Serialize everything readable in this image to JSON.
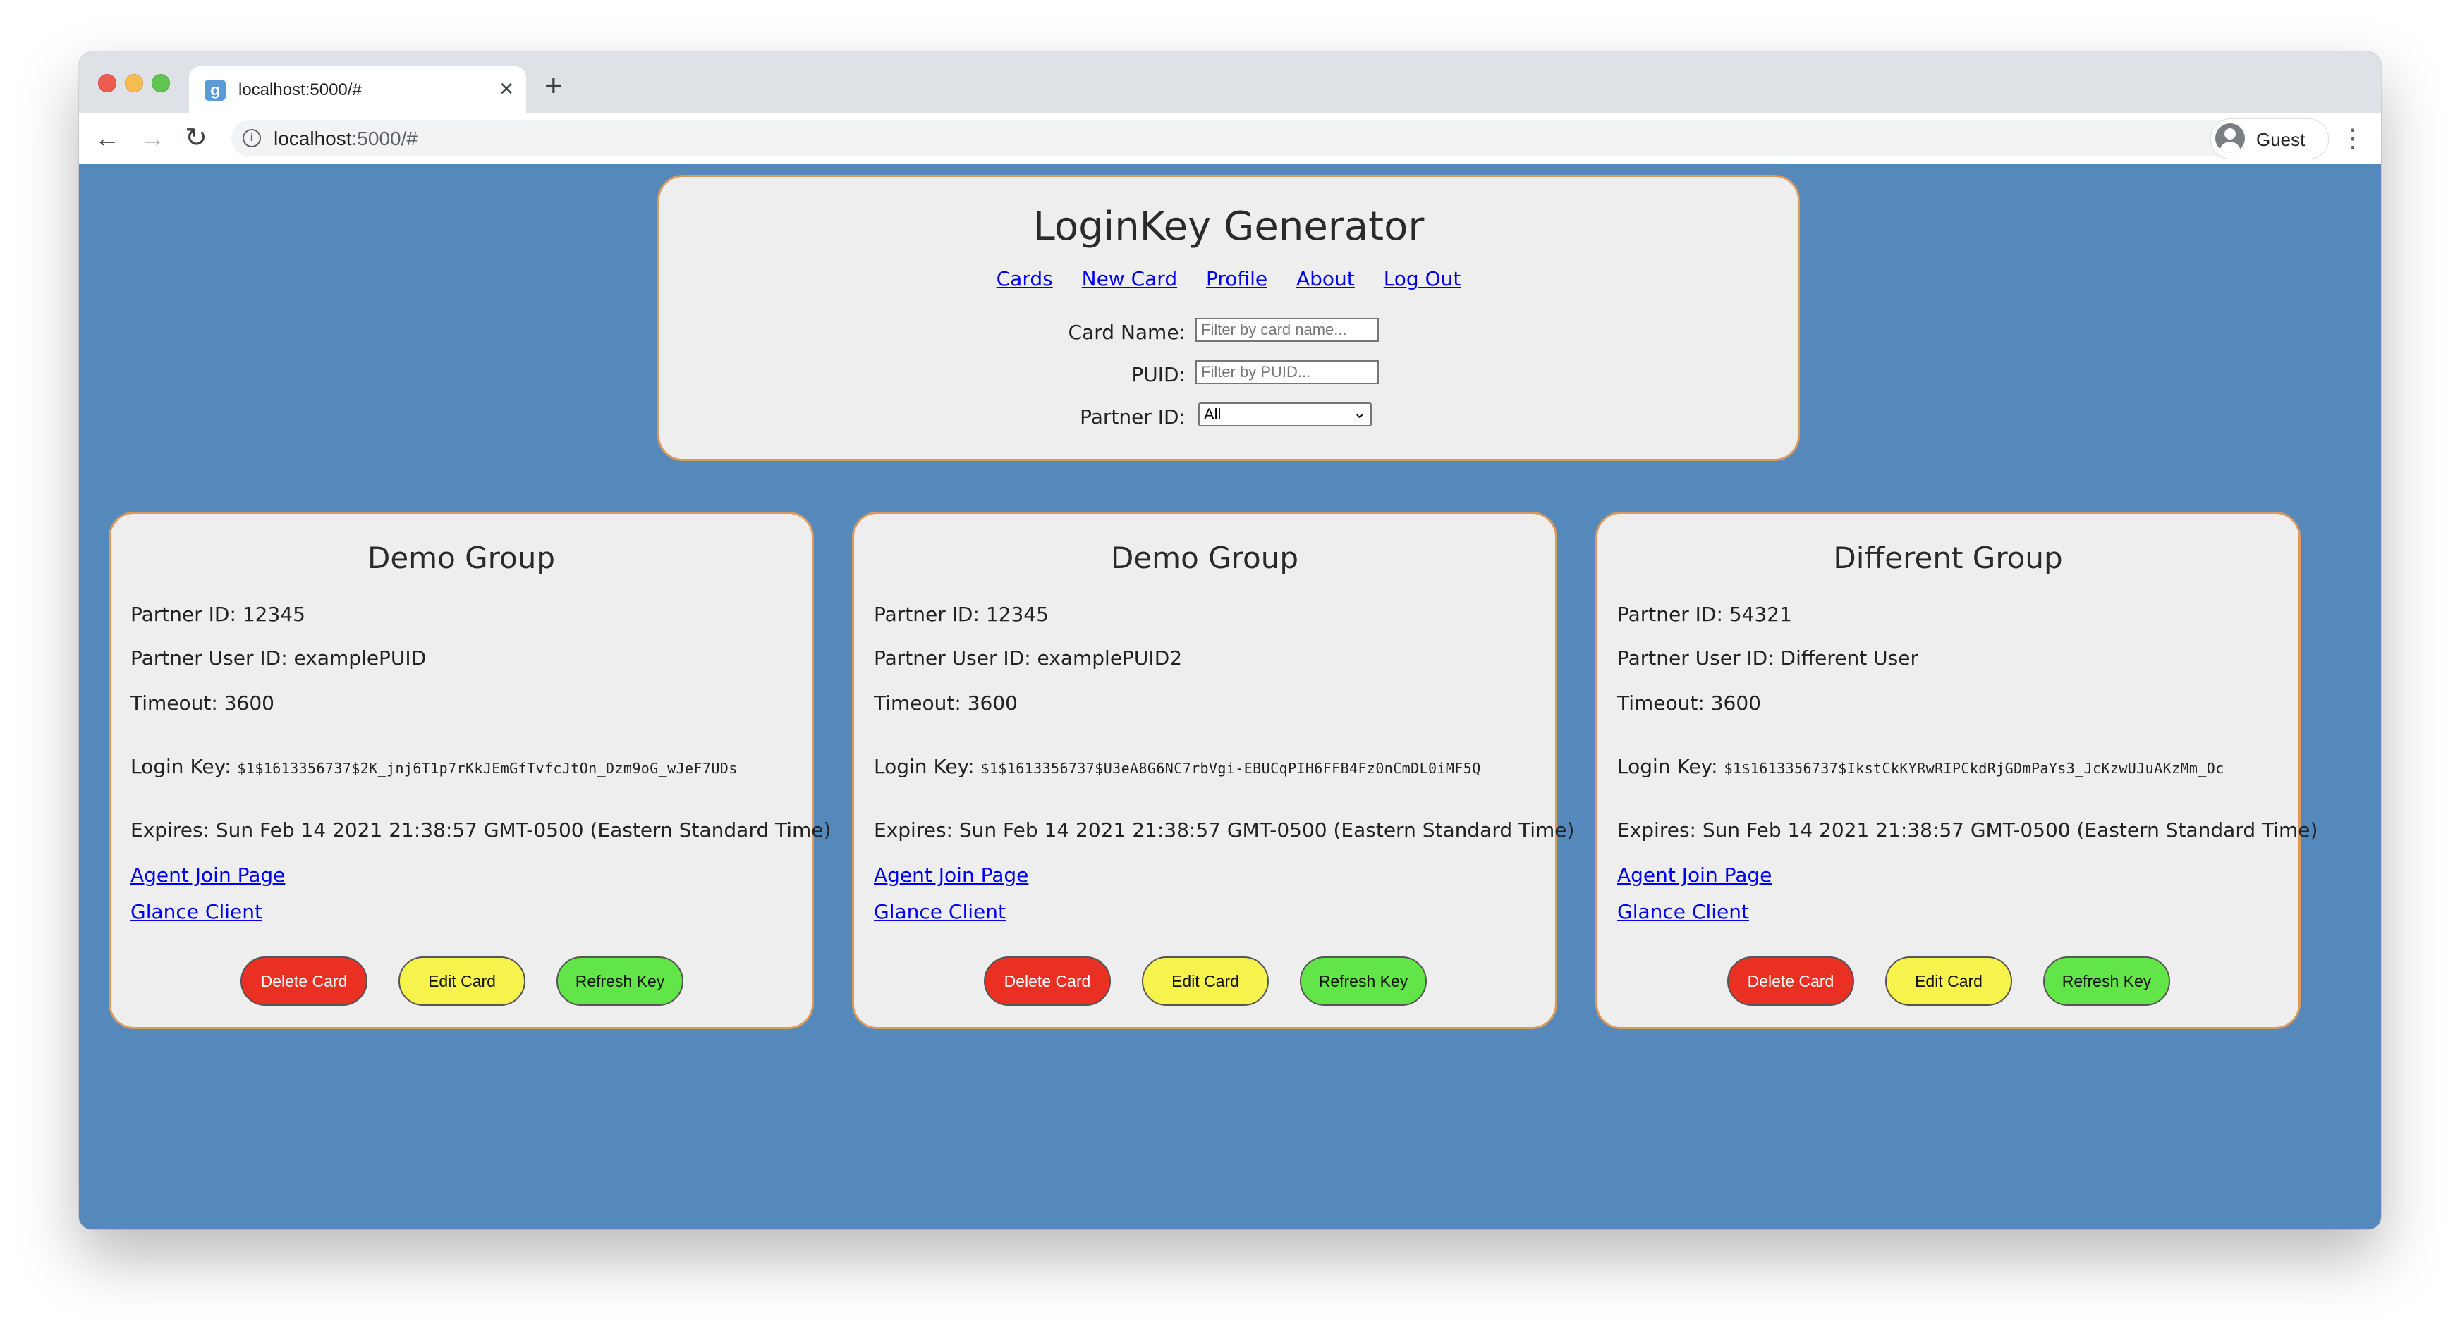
{
  "browser": {
    "tab_title": "localhost:5000/#",
    "favicon_letter": "g",
    "url_host": "localhost",
    "url_path": ":5000/#",
    "profile_name": "Guest"
  },
  "app": {
    "title": "LoginKey Generator",
    "nav": [
      "Cards",
      "New Card",
      "Profile",
      "About",
      "Log Out"
    ],
    "filters": {
      "card_name_label": "Card Name:",
      "card_name_placeholder": "Filter by card name...",
      "puid_label": "PUID:",
      "puid_placeholder": "Filter by PUID...",
      "partner_label": "Partner ID:",
      "partner_selected": "All"
    }
  },
  "cards": [
    {
      "title": "Demo Group",
      "partner_id": "Partner ID: 12345",
      "partner_user_id": "Partner User ID: examplePUID",
      "timeout": "Timeout: 3600",
      "login_key_label": "Login Key:",
      "login_key": "$1$1613356737$2K_jnj6T1p7rKkJEmGfTvfcJtOn_Dzm9oG_wJeF7UDs",
      "expires": "Expires: Sun Feb 14 2021 21:38:57 GMT-0500 (Eastern Standard Time)",
      "links": [
        "Agent Join Page",
        "Glance Client"
      ],
      "buttons": {
        "delete": "Delete Card",
        "edit": "Edit Card",
        "refresh": "Refresh Key"
      }
    },
    {
      "title": "Demo Group",
      "partner_id": "Partner ID: 12345",
      "partner_user_id": "Partner User ID: examplePUID2",
      "timeout": "Timeout: 3600",
      "login_key_label": "Login Key:",
      "login_key": "$1$1613356737$U3eA8G6NC7rbVgi-EBUCqPIH6FFB4Fz0nCmDL0iMF5Q",
      "expires": "Expires: Sun Feb 14 2021 21:38:57 GMT-0500 (Eastern Standard Time)",
      "links": [
        "Agent Join Page",
        "Glance Client"
      ],
      "buttons": {
        "delete": "Delete Card",
        "edit": "Edit Card",
        "refresh": "Refresh Key"
      }
    },
    {
      "title": "Different Group",
      "partner_id": "Partner ID: 54321",
      "partner_user_id": "Partner User ID: Different User",
      "timeout": "Timeout: 3600",
      "login_key_label": "Login Key:",
      "login_key": "$1$1613356737$IkstCkKYRwRIPCkdRjGDmPaYs3_JcKzwUJuAKzMm_Oc",
      "expires": "Expires: Sun Feb 14 2021 21:38:57 GMT-0500 (Eastern Standard Time)",
      "links": [
        "Agent Join Page",
        "Glance Client"
      ],
      "buttons": {
        "delete": "Delete Card",
        "edit": "Edit Card",
        "refresh": "Refresh Key"
      }
    }
  ],
  "colors": {
    "page_background": "#5689bb",
    "card_background": "#eeeeee",
    "card_border": "#d99a5b",
    "delete_button": "#ea2f23",
    "edit_button": "#f7f34d",
    "refresh_button": "#62e548",
    "link": "#0000ee"
  }
}
